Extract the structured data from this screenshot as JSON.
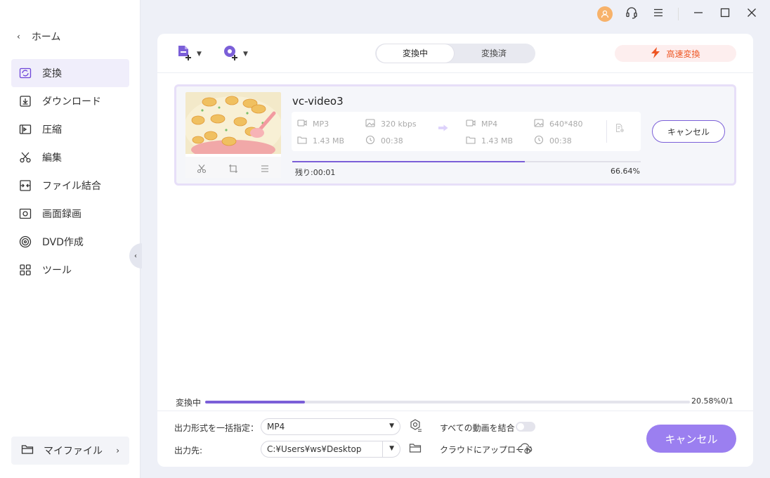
{
  "titlebar": {
    "icons": [
      "user-avatar-icon",
      "headset-icon",
      "menu-icon",
      "minimize-icon",
      "maximize-icon",
      "close-icon"
    ]
  },
  "sidebar": {
    "home_label": "ホーム",
    "items": [
      {
        "label": "変換",
        "icon": "convert-icon",
        "active": true
      },
      {
        "label": "ダウンロード",
        "icon": "download-icon"
      },
      {
        "label": "圧縮",
        "icon": "compress-icon"
      },
      {
        "label": "編集",
        "icon": "scissors-icon"
      },
      {
        "label": "ファイル結合",
        "icon": "merge-icon"
      },
      {
        "label": "画面録画",
        "icon": "screen-record-icon"
      },
      {
        "label": "DVD作成",
        "icon": "dvd-icon"
      },
      {
        "label": "ツール",
        "icon": "tools-icon"
      }
    ],
    "myfile_label": "マイファイル"
  },
  "toolbar": {
    "tabs": [
      {
        "label": "変換中",
        "active": true
      },
      {
        "label": "変換済"
      }
    ],
    "fast_label": "高速変換"
  },
  "task": {
    "filename": "vc-video3",
    "source": {
      "format": "MP3",
      "bitrate": "320 kbps",
      "size": "1.43 MB",
      "duration": "00:38"
    },
    "target": {
      "format": "MP4",
      "resolution": "640*480",
      "size": "1.43 MB",
      "duration": "00:38"
    },
    "cancel_label": "キャンセル",
    "remaining": "残り:00:01",
    "progress_text": "66.64%",
    "progress": 0.6664
  },
  "overall": {
    "label": "変換中",
    "percent_text": "20.58%",
    "percent": 0.2058,
    "count": "0/1"
  },
  "bottom": {
    "format_label": "出力形式を一括指定：",
    "format_value": "MP4",
    "merge_label": "すべての動画を結合",
    "output_label": "出力先:",
    "output_value": "C:¥Users¥ws¥Desktop",
    "cloud_label": "クラウドにアップロード",
    "cancel_label": "キャンセル"
  },
  "colors": {
    "accent": "#7b5fd8",
    "fast": "#ee5522",
    "cancel_bg": "#9b7ff0"
  }
}
